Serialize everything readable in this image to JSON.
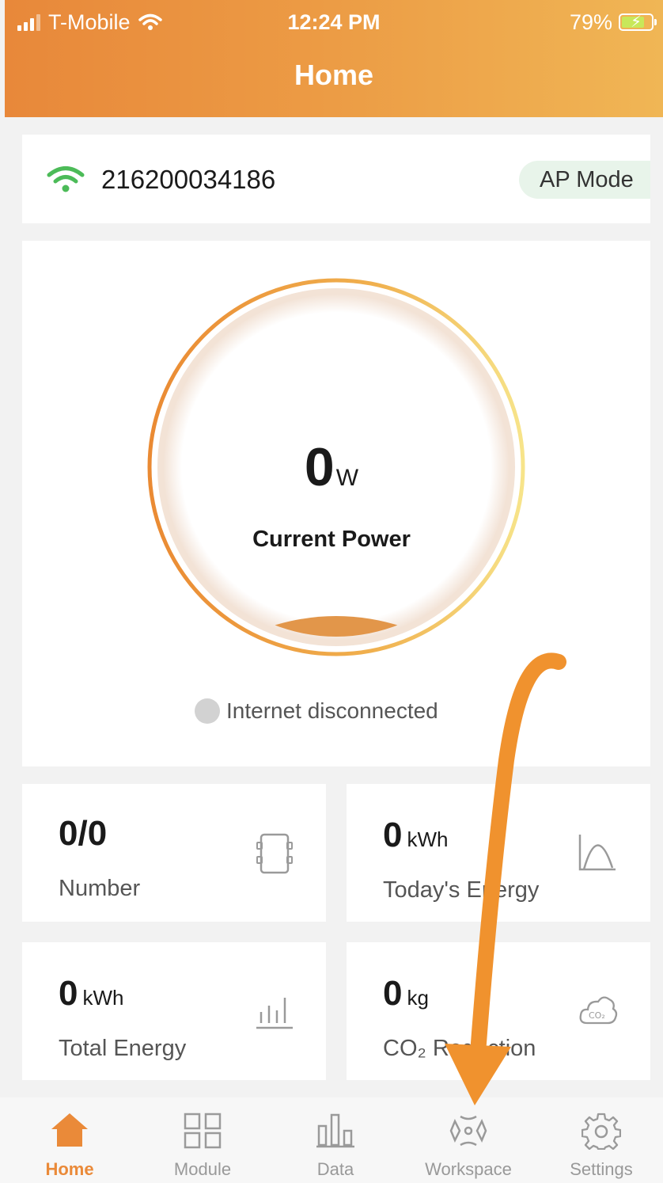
{
  "status_bar": {
    "carrier": "T-Mobile",
    "time": "12:24 PM",
    "battery": "79%",
    "battery_level": 0.79
  },
  "header": {
    "title": "Home"
  },
  "device": {
    "id": "216200034186",
    "mode": "AP Mode"
  },
  "power": {
    "value": "0",
    "unit": "W",
    "label": "Current Power",
    "internet_status": "Internet disconnected"
  },
  "stats": {
    "number": {
      "value": "0/0",
      "label": "Number"
    },
    "today_energy": {
      "value": "0",
      "unit": "kWh",
      "label": "Today's Energy"
    },
    "total_energy": {
      "value": "0",
      "unit": "kWh",
      "label": "Total Energy"
    },
    "co2": {
      "value": "0",
      "unit": "kg",
      "label": "CO₂ Reduction"
    }
  },
  "tabs": [
    {
      "label": "Home",
      "icon": "home-icon",
      "active": true
    },
    {
      "label": "Module",
      "icon": "grid-icon",
      "active": false
    },
    {
      "label": "Data",
      "icon": "bar-chart-icon",
      "active": false
    },
    {
      "label": "Workspace",
      "icon": "workspace-icon",
      "active": false
    },
    {
      "label": "Settings",
      "icon": "gear-icon",
      "active": false
    }
  ],
  "colors": {
    "accent": "#ea8a39",
    "header_start": "#e8883a",
    "header_end": "#f0b655",
    "wifi_green": "#4cbb58",
    "arrow": "#f0922e"
  }
}
